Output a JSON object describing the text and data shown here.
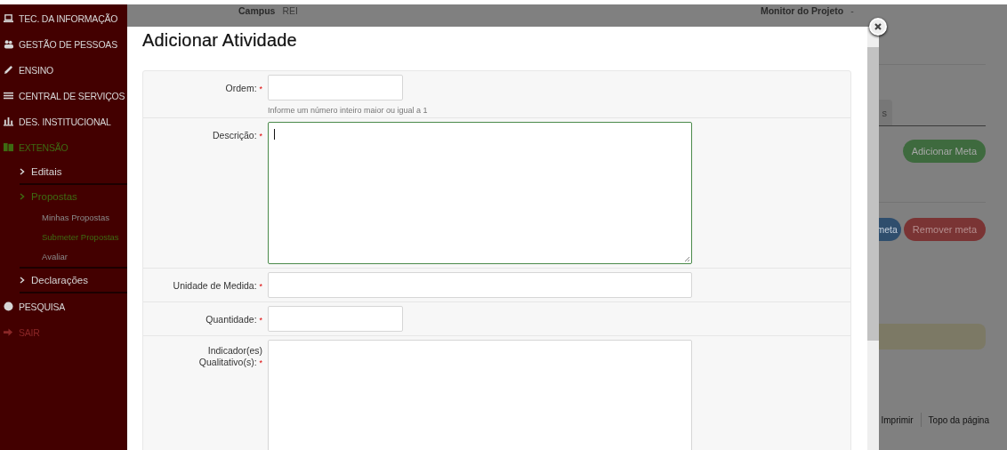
{
  "page_header": {
    "campus_label": "Campus",
    "campus_value": "REI",
    "monitor_label": "Monitor do Projeto",
    "monitor_value": "-"
  },
  "sidebar": {
    "items": [
      {
        "label": "TEC. DA INFORMAÇÃO",
        "kind": "section",
        "selected": false
      },
      {
        "label": "GESTÃO DE PESSOAS",
        "kind": "section",
        "selected": false
      },
      {
        "label": "ENSINO",
        "kind": "section",
        "selected": false
      },
      {
        "label": "CENTRAL DE SERVIÇOS",
        "kind": "section",
        "selected": false
      },
      {
        "label": "DES. INSTITUCIONAL",
        "kind": "section",
        "selected": false
      },
      {
        "label": "EXTENSÃO",
        "kind": "section",
        "selected": true,
        "children": [
          {
            "label": "Editais",
            "selected": false
          },
          {
            "label": "Propostas",
            "selected": true,
            "children": [
              {
                "label": "Minhas Propostas",
                "selected": false
              },
              {
                "label": "Submeter Propostas",
                "selected": true
              },
              {
                "label": "Avaliar",
                "selected": false
              }
            ]
          },
          {
            "label": "Declarações",
            "selected": false
          }
        ]
      },
      {
        "label": "PESQUISA",
        "kind": "section",
        "selected": false
      },
      {
        "label": "SAIR",
        "kind": "exit",
        "selected": false
      }
    ]
  },
  "background": {
    "tab_label": "s",
    "add_button": "Adicionar Meta",
    "edit_button": "meta",
    "remove_button": "Remover meta",
    "footer_links": [
      "Imprimir",
      "Topo da página"
    ]
  },
  "modal": {
    "title": "Adicionar Atividade",
    "fields": [
      {
        "label": "Ordem:",
        "required_mark": "*",
        "kind": "short",
        "focused": false,
        "help": "Informe um número inteiro maior ou igual a 1"
      },
      {
        "label": "Descrição:",
        "required_mark": "*",
        "kind": "textarea",
        "focused": true
      },
      {
        "label": "Unidade de Medida:",
        "required_mark": "*",
        "kind": "long",
        "focused": false
      },
      {
        "label": "Quantidade:",
        "required_mark": "*",
        "kind": "short",
        "focused": false
      },
      {
        "label": "Indicador(es) Qualitativo(s):",
        "required_mark": "*",
        "kind": "textarea_cut",
        "focused": false
      }
    ]
  }
}
